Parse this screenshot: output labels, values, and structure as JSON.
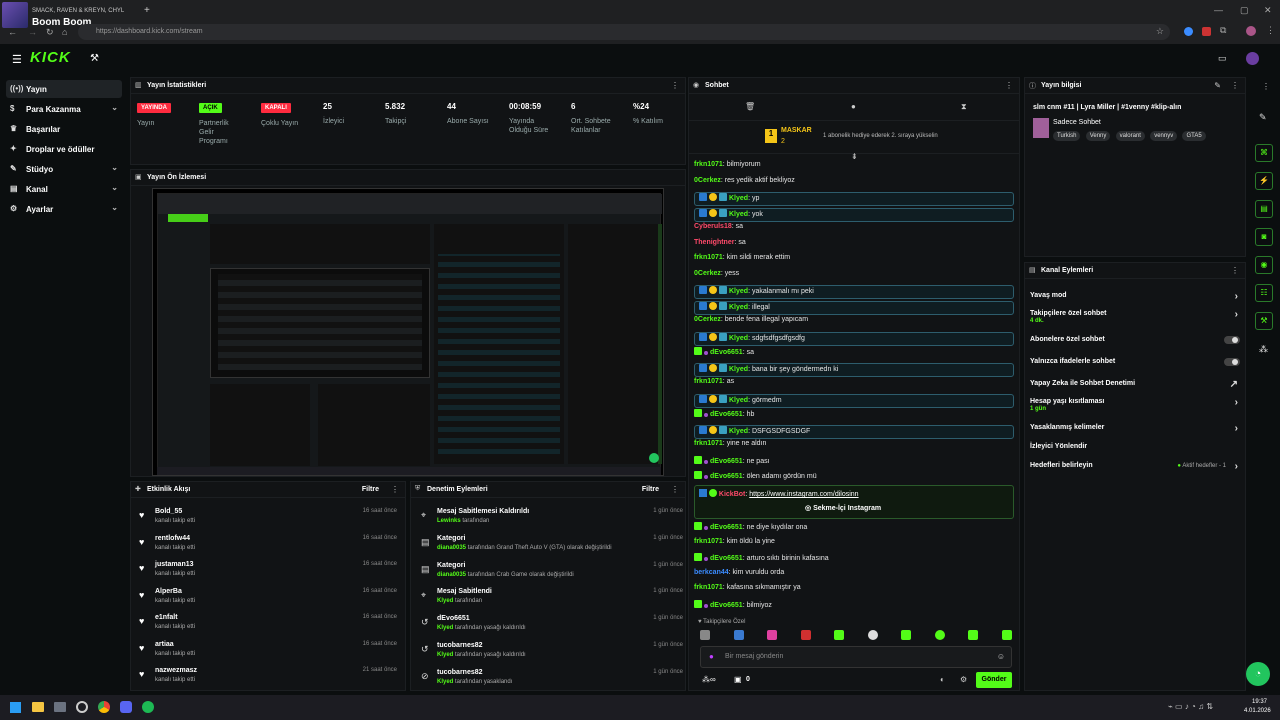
{
  "browser": {
    "tab_subtitle": "SMACK, RAVEN & KREYN, CHYL",
    "tab_title": "Boom Boom",
    "url": "https://dashboard.kick.com/stream",
    "win_min": "—",
    "win_max": "▢",
    "win_close": "✕",
    "new_tab": "+"
  },
  "logo": "KICK",
  "nav": [
    {
      "label": "Yayın",
      "icon": "((•))",
      "chevron": ""
    },
    {
      "label": "Para Kazanma",
      "icon": "$",
      "chevron": "⌄"
    },
    {
      "label": "Başarılar",
      "icon": "♛",
      "chevron": ""
    },
    {
      "label": "Droplar ve ödüller",
      "icon": "✦",
      "chevron": ""
    },
    {
      "label": "Stüdyo",
      "icon": "✎",
      "chevron": "⌄"
    },
    {
      "label": "Kanal",
      "icon": "▤",
      "chevron": "⌄"
    },
    {
      "label": "Ayarlar",
      "icon": "⚙",
      "chevron": "⌄"
    }
  ],
  "stats": {
    "title": "Yayın İstatistikleri",
    "items": [
      {
        "badge": "YAYINDA",
        "label": "Yayın"
      },
      {
        "badge": "AÇIK",
        "label": "Partnerlik Gelir Programı"
      },
      {
        "badge": "KAPALI",
        "label": "Çoklu Yayın"
      },
      {
        "value": "25",
        "label": "İzleyici"
      },
      {
        "value": "5.832",
        "label": "Takipçi"
      },
      {
        "value": "44",
        "label": "Abone Sayısı"
      },
      {
        "value": "00:08:59",
        "label": "Yayında Olduğu Süre"
      },
      {
        "value": "6",
        "label": "Ort. Sohbete Katılanlar"
      },
      {
        "value": "%24",
        "label": "% Katılım"
      }
    ]
  },
  "preview": {
    "title": "Yayın Ön İzlemesi"
  },
  "activity": {
    "title": "Etkinlik Akışı",
    "filter": "Filtre",
    "rows": [
      {
        "name": "Bold_55",
        "sub": "kanalı takip etti",
        "time": "16 saat önce"
      },
      {
        "name": "rentlofw44",
        "sub": "kanalı takip etti",
        "time": "16 saat önce"
      },
      {
        "name": "justaman13",
        "sub": "kanalı takip etti",
        "time": "16 saat önce"
      },
      {
        "name": "AlperBa",
        "sub": "kanalı takip etti",
        "time": "16 saat önce"
      },
      {
        "name": "e1nfalt",
        "sub": "kanalı takip etti",
        "time": "16 saat önce"
      },
      {
        "name": "artiaa",
        "sub": "kanalı takip etti",
        "time": "16 saat önce"
      },
      {
        "name": "nazwezmasz",
        "sub": "kanalı takip etti",
        "time": "21 saat önce"
      }
    ]
  },
  "modlog": {
    "title": "Denetim Eylemleri",
    "filter": "Filtre",
    "rows": [
      {
        "icon": "⌖",
        "name": "Mesaj Sabitlemesi Kaldırıldı",
        "user": "Lewinks",
        "sub": " tarafından",
        "time": "1 gün önce"
      },
      {
        "icon": "▤",
        "name": "Kategori",
        "user": "diana0035",
        "sub": " tarafından Grand Theft Auto V (GTA) olarak değiştirildi",
        "time": "1 gün önce"
      },
      {
        "icon": "▤",
        "name": "Kategori",
        "user": "diana0035",
        "sub": " tarafından Crab Game olarak değiştirildi",
        "time": "1 gün önce"
      },
      {
        "icon": "⌖",
        "name": "Mesaj Sabitlendi",
        "user": "Klyed",
        "sub": " tarafından",
        "time": "1 gün önce"
      },
      {
        "icon": "↺",
        "name": "dEvo6651",
        "user": "Klyed",
        "sub": " tarafından yasağı kaldırıldı",
        "time": "1 gün önce"
      },
      {
        "icon": "↺",
        "name": "tucobarnes82",
        "user": "Klyed",
        "sub": " tarafından yasağı kaldırıldı",
        "time": "1 gün önce"
      },
      {
        "icon": "⊘",
        "name": "tucobarnes82",
        "user": "Klyed",
        "sub": " tarafından yasaklandı",
        "time": "1 gün önce"
      }
    ]
  },
  "chat": {
    "title": "Sohbet",
    "pinned_user": "MASKAR",
    "pinned_count": "2",
    "pinned_text": "1 abonelik hediye ederek 2. sıraya yükselin",
    "messages": [
      {
        "user": "frkn1071",
        "text": "bilmiyorum",
        "color": "#53fc18",
        "hl": false
      },
      {
        "user": "0Cerkez",
        "text": "res yedik aktif bekliyoz",
        "color": "#53fc18",
        "hl": false
      },
      {
        "user": "Klyed",
        "text": "yp",
        "color": "#53fc18",
        "hl": true
      },
      {
        "user": "Klyed",
        "text": "yok",
        "color": "#53fc18",
        "hl": true
      },
      {
        "user": "Cyberuls18",
        "text": "sa",
        "color": "#ff4a6a",
        "hl": false
      },
      {
        "user": "Thenightner",
        "text": "sa",
        "color": "#ff4a6a",
        "hl": false
      },
      {
        "user": "frkn1071",
        "text": "kim sildi merak ettim",
        "color": "#53fc18",
        "hl": false
      },
      {
        "user": "0Cerkez",
        "text": "yess",
        "color": "#53fc18",
        "hl": false
      },
      {
        "user": "Klyed",
        "text": "yakalanmalı mı peki",
        "color": "#53fc18",
        "hl": true
      },
      {
        "user": "Klyed",
        "text": "illegal",
        "color": "#53fc18",
        "hl": true
      },
      {
        "user": "0Cerkez",
        "text": "bende fena illegal yapıcam",
        "color": "#53fc18",
        "hl": false
      },
      {
        "user": "Klyed",
        "text": "sdgfsdfgsdfgsdfg",
        "color": "#53fc18",
        "hl": true
      },
      {
        "user": "dEvo6651",
        "text": "sa",
        "color": "#53fc18",
        "hl": false
      },
      {
        "user": "Klyed",
        "text": "bana bir şey göndermedn ki",
        "color": "#53fc18",
        "hl": true
      },
      {
        "user": "frkn1071",
        "text": "as",
        "color": "#53fc18",
        "hl": false
      },
      {
        "user": "Klyed",
        "text": "görmedm",
        "color": "#53fc18",
        "hl": true
      },
      {
        "user": "dEvo6651",
        "text": "hb",
        "color": "#53fc18",
        "hl": false
      },
      {
        "user": "Klyed",
        "text": "DSFGSDFGSDGF",
        "color": "#53fc18",
        "hl": true
      },
      {
        "user": "frkn1071",
        "text": "yine ne aldın",
        "color": "#53fc18",
        "hl": false
      },
      {
        "user": "dEvo6651",
        "text": "ne pası",
        "color": "#53fc18",
        "hl": false
      },
      {
        "user": "dEvo6651",
        "text": "ölen adamı gördün mü",
        "color": "#53fc18",
        "hl": false
      }
    ],
    "kickbot_user": "KickBot",
    "kickbot_link": "https://www.instagram.com/dilosinn",
    "kickbot_button": "Sekme-İçi Instagram",
    "messages2": [
      {
        "user": "dEvo6651",
        "text": "ne diye kıydılar ona",
        "color": "#53fc18",
        "hl": false
      },
      {
        "user": "frkn1071",
        "text": "kim öldü la yine",
        "color": "#53fc18",
        "hl": false
      },
      {
        "user": "dEvo6651",
        "text": "arturo sıktı birinin kafasına",
        "color": "#53fc18",
        "hl": false
      },
      {
        "user": "berkcan44",
        "text": "kim vuruldu orda",
        "color": "#3b8cff",
        "hl": false
      },
      {
        "user": "frkn1071",
        "text": "kafasına sıkmamıştır ya",
        "color": "#53fc18",
        "hl": false
      },
      {
        "user": "dEvo6651",
        "text": "bilmiyoz",
        "color": "#53fc18",
        "hl": false
      }
    ],
    "followers_only": "Takipçilere Özel",
    "input_placeholder": "Bir mesaj gönderin",
    "points": "0",
    "send": "Gönder"
  },
  "stream_info": {
    "title": "Yayın bilgisi",
    "stream_title": "slm cnm #11 | Lyra Miller | #1venny #klip-alın",
    "category": "Sadece Sohbet",
    "tags": [
      "Turkish",
      "Venny",
      "valorant",
      "vennyv",
      "GTA5"
    ]
  },
  "channel_actions": {
    "title": "Kanal Eylemleri",
    "items": [
      {
        "label": "Yavaş mod",
        "sub": "",
        "control": "›"
      },
      {
        "label": "Takipçilere özel sohbet",
        "sub": "4 dk.",
        "control": "›"
      },
      {
        "label": "Abonelere özel sohbet",
        "sub": "",
        "control": "toggle"
      },
      {
        "label": "Yalnızca ifadelerle sohbet",
        "sub": "",
        "control": "toggle"
      },
      {
        "label": "Yapay Zeka ile Sohbet Denetimi",
        "sub": "",
        "control": "↗"
      },
      {
        "label": "Hesap yaşı kısıtlaması",
        "sub": "1 gün",
        "control": "›"
      },
      {
        "label": "Yasaklanmış kelimeler",
        "sub": "",
        "control": "›"
      },
      {
        "label": "İzleyici Yönlendir",
        "sub": "",
        "control": ""
      },
      {
        "label": "Hedefleri belirleyin",
        "sub": "",
        "control": "›",
        "extra": "Aktif hedefler - 1"
      }
    ]
  },
  "taskbar": {
    "time": "19:37",
    "date": "4.01.2026"
  },
  "colors": {
    "accent": "#53fc18",
    "live": "#ff2b3f",
    "bg": "#0b0e0f",
    "panel": "#111315"
  }
}
